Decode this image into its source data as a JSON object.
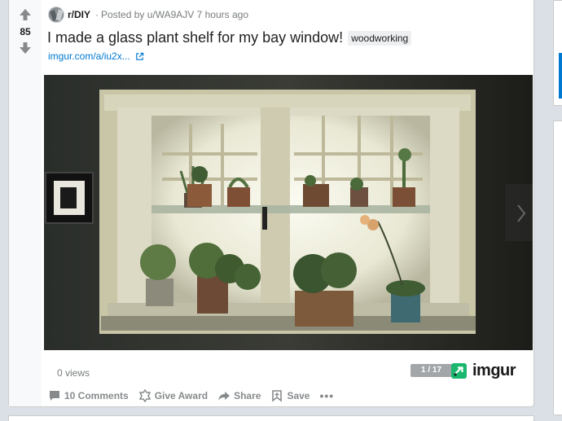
{
  "post": {
    "score": "85",
    "subreddit": "r/DIY",
    "posted_by": "Posted by u/WA9AJV 7 hours ago",
    "title": "I made a glass plant shelf for my bay window!",
    "flair": "woodworking",
    "link": "imgur.com/a/iu2x...",
    "views": "0 views",
    "gallery_counter": "1 / 17",
    "media_source": "imgur"
  },
  "actions": {
    "comments": "10 Comments",
    "give_award": "Give Award",
    "share": "Share",
    "save": "Save",
    "more": "•••"
  },
  "colors": {
    "link": "#0079d3",
    "imgur_green": "#1bb76e",
    "meta_gray": "#787c7e"
  },
  "icons": [
    "upvote-arrow-icon",
    "downvote-arrow-icon",
    "external-link-icon",
    "comment-icon",
    "award-icon",
    "share-icon",
    "save-icon",
    "more-icon",
    "imgur-logo-icon"
  ]
}
